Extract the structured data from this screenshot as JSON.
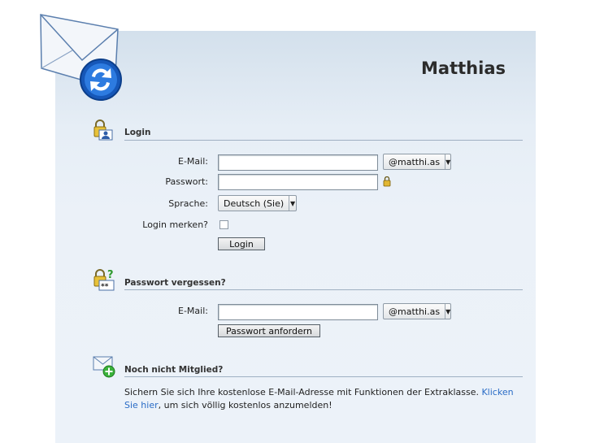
{
  "brand": {
    "name": "Matthias"
  },
  "login": {
    "title": "Login",
    "email_label": "E-Mail:",
    "email_value": "",
    "domain": "@matthi.as",
    "password_label": "Passwort:",
    "password_value": "",
    "language_label": "Sprache:",
    "language_value": "Deutsch (Sie)",
    "remember_label": "Login merken?",
    "button": "Login"
  },
  "forgot": {
    "title": "Passwort vergessen?",
    "email_label": "E-Mail:",
    "email_value": "",
    "domain": "@matthi.as",
    "button": "Passwort anfordern"
  },
  "signup": {
    "title": "Noch nicht Mitglied?",
    "text_before": "Sichern Sie sich Ihre kostenlose E-Mail-Adresse mit Funktionen der Extraklasse.",
    "link": "Klicken Sie hier",
    "text_after": ", um sich völlig kostenlos anzumelden!"
  },
  "icons": {
    "logo": "envelope-sync-icon",
    "login": "lock-user-icon",
    "forgot": "lock-question-icon",
    "signup": "envelope-add-icon",
    "password": "lock-icon",
    "dropdown": "chevron-down-icon"
  }
}
